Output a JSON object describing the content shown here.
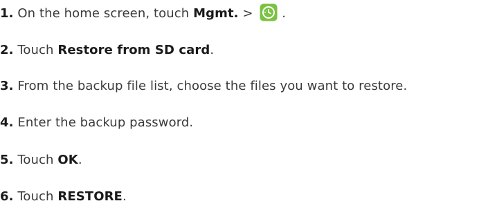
{
  "steps": [
    {
      "number": "1.",
      "text_before": "On the home screen, touch",
      "bold": "Mgmt.",
      "text_after": " > ",
      "icon": "backup-restore-app-icon",
      "trailing": " ."
    },
    {
      "number": "2.",
      "text_before": "Touch",
      "bold": "Restore from SD card",
      "text_after": "."
    },
    {
      "number": "3.",
      "text_before": "From the backup file list, choose the files you want to restore."
    },
    {
      "number": "4.",
      "text_before": "Enter the backup password."
    },
    {
      "number": "5.",
      "text_before": "Touch",
      "bold": "OK",
      "text_after": "."
    },
    {
      "number": "6.",
      "text_before": "Touch",
      "bold": "RESTORE",
      "text_after": "."
    }
  ],
  "colors": {
    "text": "#3a3a3a",
    "icon_green": "#7cc242",
    "icon_green_dark": "#5aa52a"
  }
}
